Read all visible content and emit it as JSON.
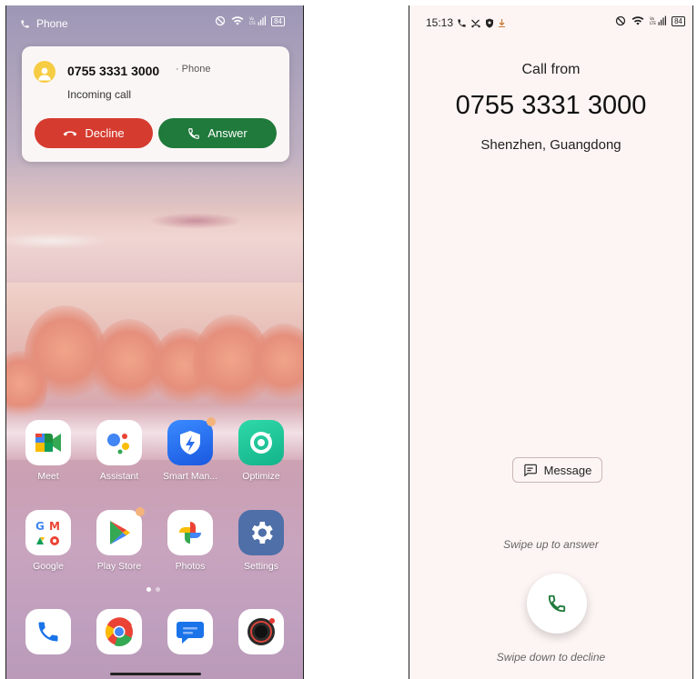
{
  "left_screen": {
    "status_bar": {
      "app_label": "Phone",
      "battery": "84"
    },
    "notification": {
      "caller": "0755 3331 3000",
      "app": "· Phone",
      "subtitle": "Incoming call",
      "decline_label": "Decline",
      "answer_label": "Answer"
    },
    "apps_row1": [
      {
        "label": "Meet",
        "icon": "google-meet-icon"
      },
      {
        "label": "Assistant",
        "icon": "google-assistant-icon"
      },
      {
        "label": "Smart Man...",
        "icon": "smart-manager-shield-icon"
      },
      {
        "label": "Optimize",
        "icon": "optimize-icon"
      }
    ],
    "apps_row2": [
      {
        "label": "Google",
        "icon": "google-folder-icon"
      },
      {
        "label": "Play Store",
        "icon": "play-store-icon"
      },
      {
        "label": "Photos",
        "icon": "google-photos-icon"
      },
      {
        "label": "Settings",
        "icon": "settings-gear-icon"
      }
    ],
    "dock": [
      {
        "icon": "phone-icon"
      },
      {
        "icon": "chrome-icon"
      },
      {
        "icon": "messages-icon"
      },
      {
        "icon": "camera-icon"
      }
    ]
  },
  "right_screen": {
    "status_bar": {
      "time": "15:13",
      "battery": "84"
    },
    "call_from": "Call from",
    "number": "0755 3331 3000",
    "location": "Shenzhen, Guangdong",
    "message_label": "Message",
    "swipe_up": "Swipe up to answer",
    "swipe_down": "Swipe down to decline"
  },
  "colors": {
    "decline": "#d63b2f",
    "answer": "#1f7a3b",
    "call_bg": "#fdf5f3"
  }
}
